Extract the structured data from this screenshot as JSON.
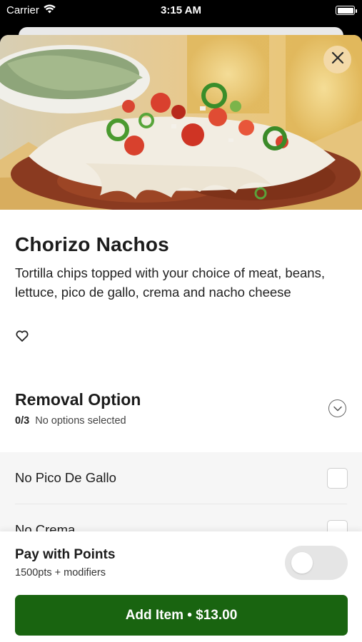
{
  "status_bar": {
    "carrier": "Carrier",
    "time": "3:15 AM"
  },
  "item": {
    "name": "Chorizo Nachos",
    "description": "Tortilla chips topped with your choice of meat, beans, lettuce, pico de gallo, crema and nacho cheese"
  },
  "removal_section": {
    "title": "Removal Option",
    "count": "0/3",
    "status": "No options selected",
    "options": [
      {
        "label": "No Pico De Gallo",
        "checked": false
      },
      {
        "label": "No Crema",
        "checked": false
      }
    ]
  },
  "pay_points": {
    "title": "Pay with Points",
    "subtitle": "1500pts + modifiers",
    "enabled": false
  },
  "add_button": {
    "label": "Add Item • $13.00"
  },
  "colors": {
    "accent_green": "#196410",
    "close_button_bg": "#f3d9a8",
    "toggle_off": "#e5e5e5"
  },
  "icons": [
    "wifi-icon",
    "battery-icon",
    "close-icon",
    "heart-icon",
    "chevron-down-icon",
    "checkbox"
  ]
}
